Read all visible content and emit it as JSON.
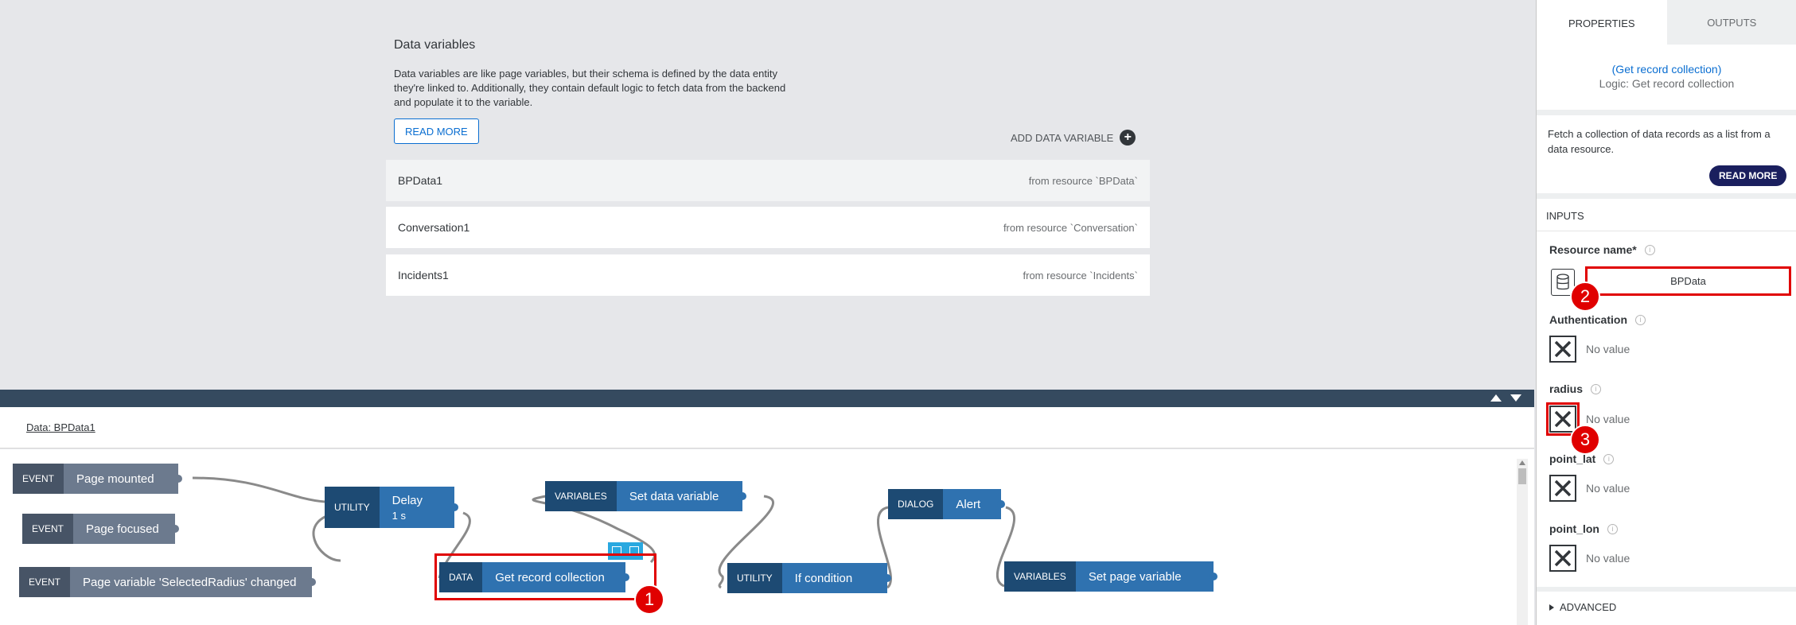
{
  "data_variables": {
    "title": "Data variables",
    "description": "Data variables are like page variables, but their schema is defined by the data entity they're linked to. Additionally, they contain default logic to fetch data from the backend and populate it to the variable.",
    "read_more": "READ MORE",
    "add_label": "ADD DATA VARIABLE",
    "items": [
      {
        "name": "BPData1",
        "source": "from resource `BPData`"
      },
      {
        "name": "Conversation1",
        "source": "from resource `Conversation`"
      },
      {
        "name": "Incidents1",
        "source": "from resource `Incidents`"
      }
    ]
  },
  "logic": {
    "title": "Data: BPData1",
    "nodes": {
      "ev1": {
        "cat": "EVENT",
        "label": "Page mounted"
      },
      "ev2": {
        "cat": "EVENT",
        "label": "Page focused"
      },
      "ev3": {
        "cat": "EVENT",
        "label": "Page variable 'SelectedRadius' changed"
      },
      "delay": {
        "cat": "UTILITY",
        "label": "Delay",
        "sub": "1 s"
      },
      "getrec": {
        "cat": "DATA",
        "label": "Get record collection"
      },
      "setdata": {
        "cat": "VARIABLES",
        "label": "Set data variable"
      },
      "ifcond": {
        "cat": "UTILITY",
        "label": "If condition"
      },
      "alert": {
        "cat": "DIALOG",
        "label": "Alert"
      },
      "setpage": {
        "cat": "VARIABLES",
        "label": "Set page variable"
      }
    }
  },
  "annotations": {
    "b1": "1",
    "b2": "2",
    "b3": "3"
  },
  "panel": {
    "tabs": {
      "properties": "PROPERTIES",
      "outputs": "OUTPUTS"
    },
    "function_link": "(Get record collection)",
    "function_logic": "Logic: Get record collection",
    "description": "Fetch a collection of data records as a list from a data resource.",
    "read_more": "READ MORE",
    "inputs_heading": "INPUTS",
    "resource_label": "Resource name*",
    "resource_value": "BPData",
    "auth_label": "Authentication",
    "radius_label": "radius",
    "lat_label": "point_lat",
    "lon_label": "point_lon",
    "no_value": "No value",
    "advanced": "ADVANCED"
  },
  "colors": {
    "accent": "#0a6ed1",
    "highlight": "#e00000",
    "shell": "#354a5f"
  }
}
